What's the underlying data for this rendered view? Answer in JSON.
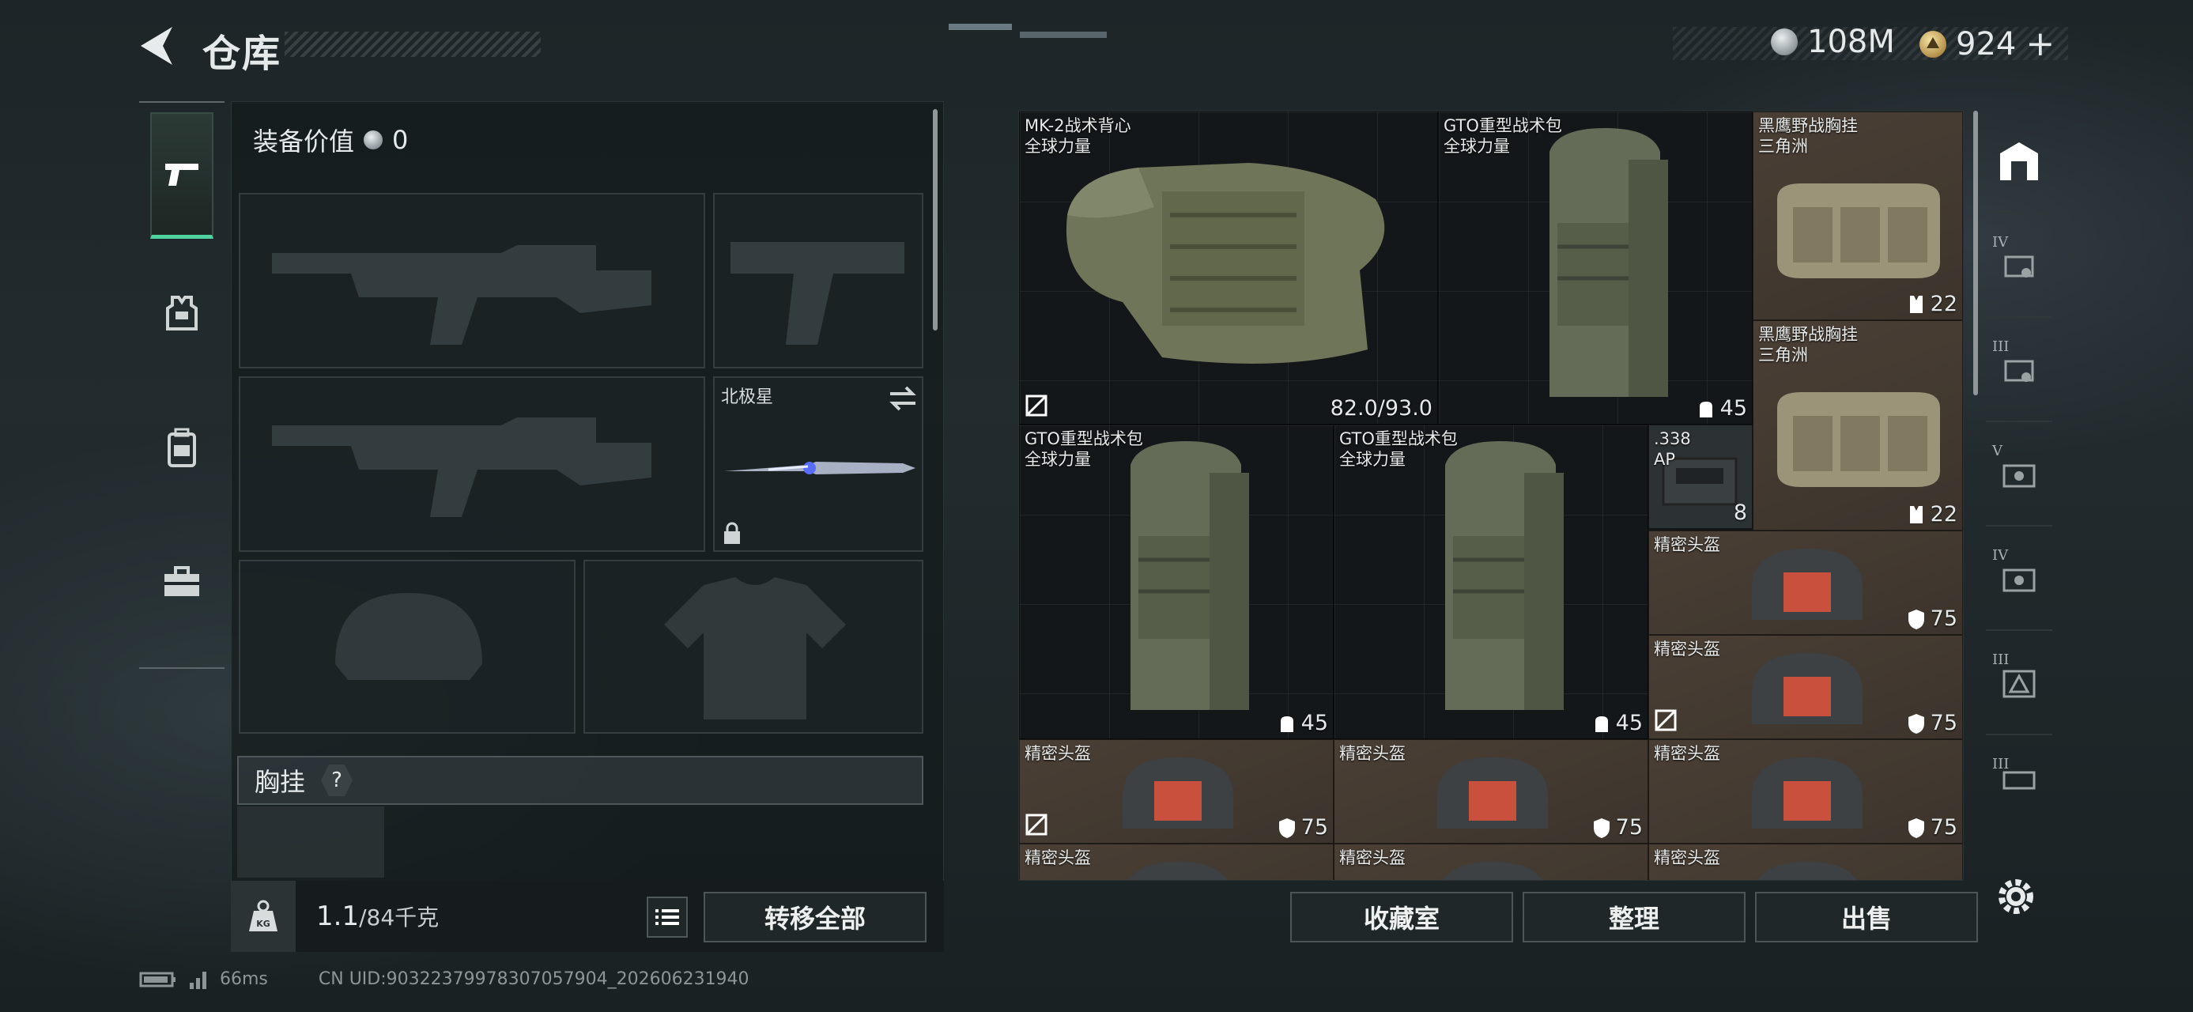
{
  "header": {
    "title": "仓库",
    "currencies": [
      {
        "icon": "silver-coin-icon",
        "value": "108M"
      },
      {
        "icon": "gold-coin-icon",
        "value": "924",
        "add": "+"
      }
    ]
  },
  "loadout": {
    "value_label": "装备价值",
    "value": "0",
    "melee_name": "北极星",
    "chest_label": "胸挂",
    "chest_help": "?",
    "weight_value": "1.1",
    "weight_total": "/84千克",
    "transfer_all": "转移全部"
  },
  "stash": {
    "items": [
      {
        "name": "MK-2战术背心",
        "sub": "全球力量",
        "stat": "82.0/93.0"
      },
      {
        "name": "GTO重型战术包",
        "sub": "全球力量",
        "stat": "45"
      },
      {
        "name": "黑鹰野战胸挂",
        "sub": "三角洲",
        "stat": "22"
      },
      {
        "name": "黑鹰野战胸挂",
        "sub": "三角洲",
        "stat": "22"
      },
      {
        "name": "GTO重型战术包",
        "sub": "全球力量",
        "stat": "45"
      },
      {
        "name": "GTO重型战术包",
        "sub": "全球力量",
        "stat": "45"
      },
      {
        "name": ".338",
        "sub": "AP",
        "stat": "8"
      },
      {
        "name": "精密头盔",
        "sub": "",
        "stat": "75"
      },
      {
        "name": "精密头盔",
        "sub": "",
        "stat": "75"
      },
      {
        "name": "精密头盔",
        "sub": "",
        "stat": "75"
      },
      {
        "name": "精密头盔",
        "sub": "",
        "stat": "75"
      },
      {
        "name": "精密头盔",
        "sub": "",
        "stat": "75"
      },
      {
        "name": "精密头盔",
        "sub": "",
        "stat": ""
      },
      {
        "name": "精密头盔",
        "sub": "",
        "stat": ""
      },
      {
        "name": "精密头盔",
        "sub": "",
        "stat": ""
      }
    ]
  },
  "filters": [
    "",
    "IV",
    "III",
    "V",
    "IV",
    "III",
    "III"
  ],
  "bottom": {
    "collection": "收藏室",
    "organize": "整理",
    "sell": "出售"
  },
  "status": {
    "ping": "66ms",
    "uid": "CN UID:9032237997830705790​4_202606231940"
  },
  "colors": {
    "accent": "#4fd2a0",
    "rarity_blue": "#2c3047",
    "rarity_red": "#5b2b31",
    "rarity_brown": "#4a3f35"
  }
}
